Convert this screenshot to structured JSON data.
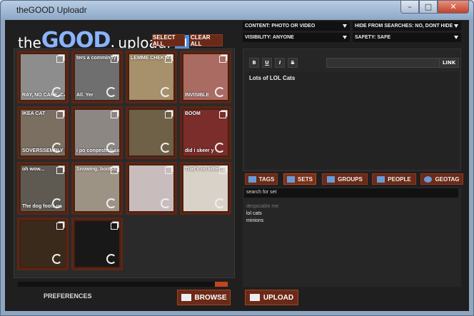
{
  "window": {
    "title": "theGOOD Uploadr",
    "min": "–",
    "max": "□",
    "close": "✕"
  },
  "logo": {
    "the": "the",
    "good": "GOOD",
    "dot": ".",
    "uploadr": "uploadr"
  },
  "toolbar": {
    "select_all": "SELECT ALL",
    "clear_all": "CLEAR ALL"
  },
  "thumbs": [
    {
      "caption": "",
      "bottom": "RAY, NO CARE, CAN HAZ",
      "color": "#8d8d8d"
    },
    {
      "caption": "ters a comminity",
      "bottom": "All. Yer",
      "color": "#6f6f6f"
    },
    {
      "caption": "LEMME CHEK MAH",
      "bottom": "",
      "color": "#a7906c"
    },
    {
      "caption": "",
      "bottom": "INVISIBLE",
      "color": "#aa6b63"
    },
    {
      "caption": "IKEA CAT",
      "bottom": "SOVERSSEMBLY REQUIRED",
      "color": "#7b6f62"
    },
    {
      "caption": "",
      "bottom": "i po conpeshsli sin pictures",
      "color": "#8d8784"
    },
    {
      "caption": "",
      "bottom": "",
      "color": "#6f6048"
    },
    {
      "caption": "BOOM",
      "bottom": "did i skeer y",
      "color": "#7a2d2b"
    },
    {
      "caption": "oh wow...",
      "bottom": "The dog fools us",
      "color": "#5e5a52"
    },
    {
      "caption": "Snowing. bootstop!",
      "bottom": "",
      "color": "#9d9384"
    },
    {
      "caption": "",
      "bottom": "",
      "color": "#c9bcbc"
    },
    {
      "caption": "That's no kitten",
      "bottom": "",
      "color": "#d9d2c9"
    },
    {
      "caption": "",
      "bottom": "",
      "color": "#3a2a1c"
    },
    {
      "caption": "",
      "bottom": "",
      "color": "#181818"
    }
  ],
  "footer": {
    "preferences": "PREFERENCES",
    "browse": "BROWSE",
    "upload": "UPLOAD"
  },
  "options": {
    "content": "CONTENT:  PHOTO OR VIDEO",
    "hide": "HIDE FROM SEARCHES:  NO, DONT HIDE",
    "visibility": "VISIBILITY:  ANYONE",
    "safety": "SAFETY:  SAFE"
  },
  "editor": {
    "bold": "B",
    "underline": "U",
    "italic": "I",
    "strike": "S",
    "link": "LINK",
    "text": "Lots of LOL Cats"
  },
  "tabs": {
    "tags": "TAGS",
    "sets": "SETS",
    "groups": "GROUPS",
    "people": "PEOPLE",
    "geotag": "GEOTAG"
  },
  "sets": {
    "search_placeholder": "search for set",
    "items": [
      {
        "label": "despicable me",
        "dim": true
      },
      {
        "label": "lol cats",
        "dim": false
      },
      {
        "label": "minions",
        "dim": false
      }
    ]
  }
}
